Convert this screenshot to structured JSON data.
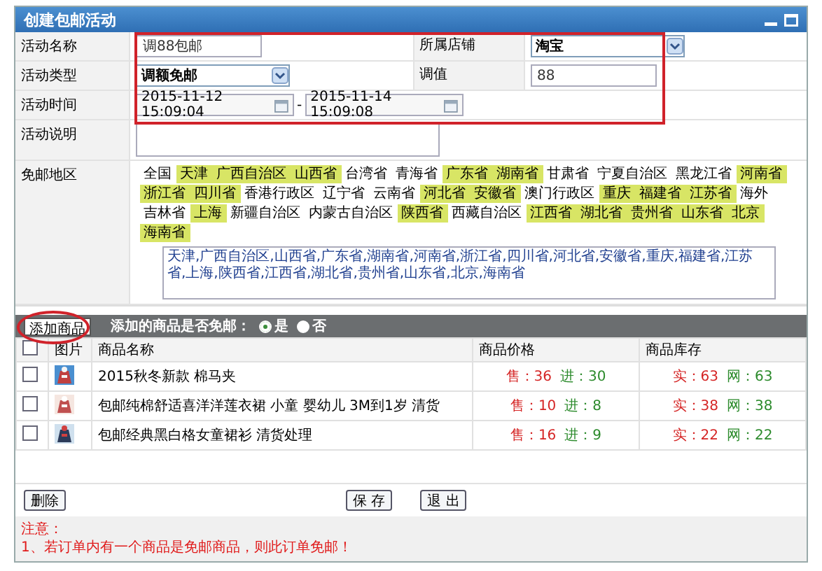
{
  "window": {
    "title": "创建包邮活动"
  },
  "activity_name": {
    "label": "活动名称",
    "value": "调88包邮"
  },
  "store": {
    "label": "所属店铺",
    "value": "淘宝"
  },
  "activity_type": {
    "label": "活动类型",
    "value": "调额免邮"
  },
  "threshold": {
    "label": "调值",
    "value": "88"
  },
  "activity_time": {
    "label": "活动时间",
    "start": "2015-11-12 15:09:04",
    "separator": "-",
    "end": "2015-11-14 15:09:08"
  },
  "description": {
    "label": "活动说明"
  },
  "free_regions": {
    "label": "免邮地区",
    "regions": [
      {
        "name": "全国",
        "selected": false
      },
      {
        "name": "天津",
        "selected": true
      },
      {
        "name": "广西自治区",
        "selected": true
      },
      {
        "name": "山西省",
        "selected": true
      },
      {
        "name": "台湾省",
        "selected": false
      },
      {
        "name": "青海省",
        "selected": false
      },
      {
        "name": "广东省",
        "selected": true
      },
      {
        "name": "湖南省",
        "selected": true
      },
      {
        "name": "甘肃省",
        "selected": false
      },
      {
        "name": "宁夏自治区",
        "selected": false
      },
      {
        "name": "黑龙江省",
        "selected": false
      },
      {
        "name": "河南省",
        "selected": true
      },
      {
        "name": "浙江省",
        "selected": true
      },
      {
        "name": "四川省",
        "selected": true
      },
      {
        "name": "香港行政区",
        "selected": false
      },
      {
        "name": "辽宁省",
        "selected": false
      },
      {
        "name": "云南省",
        "selected": false
      },
      {
        "name": "河北省",
        "selected": true
      },
      {
        "name": "安徽省",
        "selected": true
      },
      {
        "name": "澳门行政区",
        "selected": false
      },
      {
        "name": "重庆",
        "selected": true
      },
      {
        "name": "福建省",
        "selected": true
      },
      {
        "name": "江苏省",
        "selected": true
      },
      {
        "name": "海外",
        "selected": false
      },
      {
        "name": "吉林省",
        "selected": false
      },
      {
        "name": "上海",
        "selected": true
      },
      {
        "name": "新疆自治区",
        "selected": false
      },
      {
        "name": "内蒙古自治区",
        "selected": false
      },
      {
        "name": "陕西省",
        "selected": true
      },
      {
        "name": "西藏自治区",
        "selected": false
      },
      {
        "name": "江西省",
        "selected": true
      },
      {
        "name": "湖北省",
        "selected": true
      },
      {
        "name": "贵州省",
        "selected": true
      },
      {
        "name": "山东省",
        "selected": true
      },
      {
        "name": "北京",
        "selected": true
      },
      {
        "name": "海南省",
        "selected": true
      }
    ],
    "value": "天津,广西自治区,山西省,广东省,湖南省,河南省,浙江省,四川省,河北省,安徽省,重庆,福建省,江苏省,上海,陕西省,江西省,湖北省,贵州省,山东省,北京,海南省"
  },
  "products": {
    "add_button": "添加商品",
    "question": "添加的商品是否免邮：",
    "options": [
      {
        "label": "是",
        "selected": true
      },
      {
        "label": "否",
        "selected": false
      }
    ],
    "select_all_checked": false,
    "columns": [
      "图片",
      "商品名称",
      "商品价格",
      "商品库存"
    ],
    "rows": [
      {
        "checked": false,
        "name": "2015秋冬新款 棉马夹",
        "price": [
          {
            "kind": "sale",
            "text": "售：36"
          },
          {
            "kind": "cost",
            "text": "进：30"
          }
        ],
        "stock": [
          {
            "kind": "real",
            "text": "实：63"
          },
          {
            "kind": "online",
            "text": "网：63"
          }
        ]
      },
      {
        "checked": false,
        "name": "包邮纯棉舒适喜洋洋莲衣裙 小童 婴幼儿 3M到1岁 清货",
        "price": [
          {
            "kind": "sale",
            "text": "售：10"
          },
          {
            "kind": "cost",
            "text": "进：8"
          }
        ],
        "stock": [
          {
            "kind": "real",
            "text": "实：38"
          },
          {
            "kind": "online",
            "text": "网：38"
          }
        ]
      },
      {
        "checked": false,
        "name": "包邮经典黑白格女童裙衫 清货处理",
        "price": [
          {
            "kind": "sale",
            "text": "售：16"
          },
          {
            "kind": "cost",
            "text": "进：9"
          }
        ],
        "stock": [
          {
            "kind": "real",
            "text": "实：22"
          },
          {
            "kind": "online",
            "text": "网：22"
          }
        ]
      }
    ]
  },
  "buttons": {
    "delete": "删除",
    "save": "保 存",
    "exit": "退 出"
  },
  "notes": {
    "title": "注意：",
    "items": [
      "1、若订单内有一个商品是免邮商品，则此订单免邮！"
    ]
  }
}
